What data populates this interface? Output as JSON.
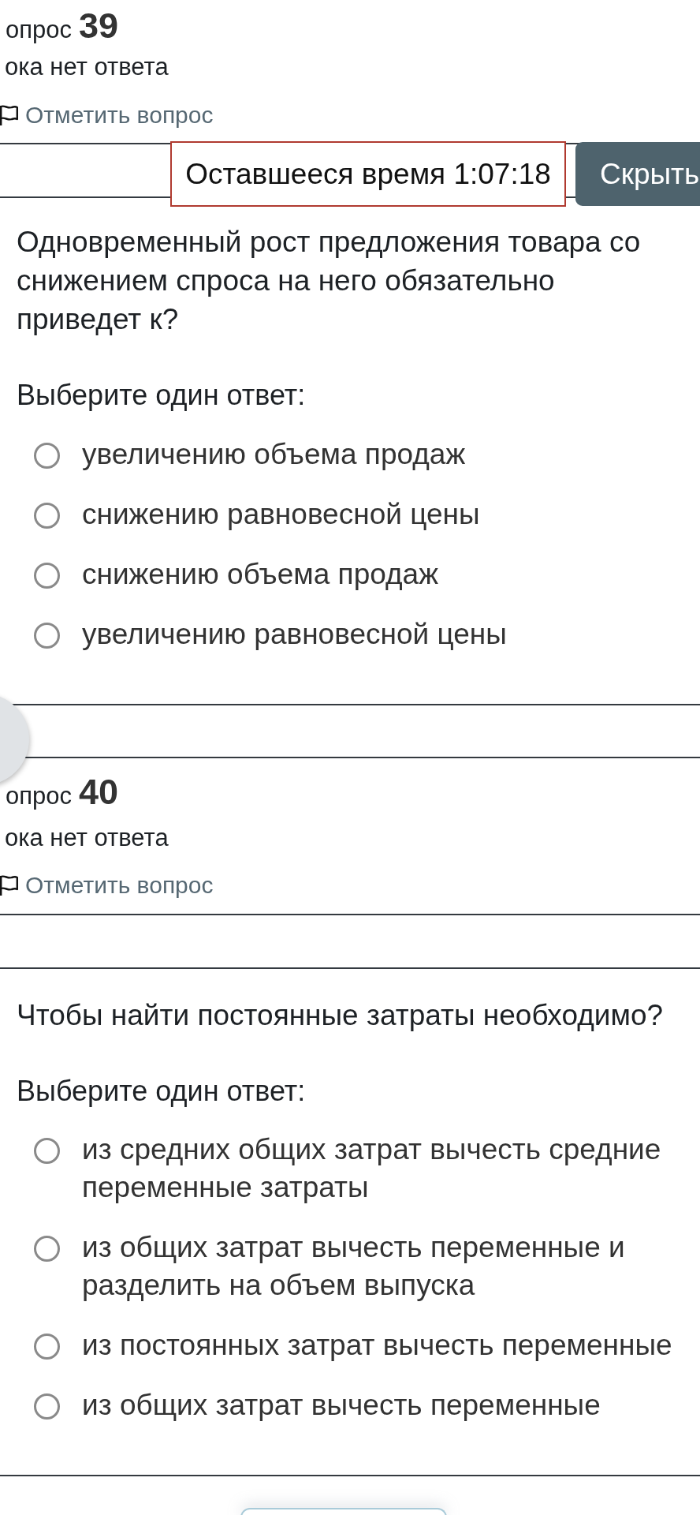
{
  "questions": [
    {
      "label": "опрос",
      "number": "39",
      "status": "ока нет ответа",
      "flag_link": "Отметить вопрос",
      "timer": {
        "text": "Оставшееся время 1:07:18",
        "hide_button": "Скрыть"
      },
      "text": "Одновременный рост предложения товара со снижением спроса на него обязательно приведет к?",
      "prompt": "Выберите один ответ:",
      "options": [
        {
          "text": "увеличению объема продаж",
          "selected": false
        },
        {
          "text": "снижению равновесной цены",
          "selected": false
        },
        {
          "text": "снижению объема продаж",
          "selected": false
        },
        {
          "text": "увеличению равновесной цены",
          "selected": false
        }
      ]
    },
    {
      "label": "опрос",
      "number": "40",
      "status": "ока нет ответа",
      "flag_link": "Отметить вопрос",
      "text": "Чтобы найти постоянные затраты необходимо?",
      "prompt": "Выберите один ответ:",
      "options": [
        {
          "text": "из средних общих затрат вычесть средние переменные затраты",
          "selected": false
        },
        {
          "text": "из общих затрат вычесть переменные и разделить на объем выпуска",
          "selected": false
        },
        {
          "text": "из постоянных затрат вычесть переменные",
          "selected": false
        },
        {
          "text": "из общих затрат вычесть переменные",
          "selected": false
        }
      ]
    }
  ]
}
